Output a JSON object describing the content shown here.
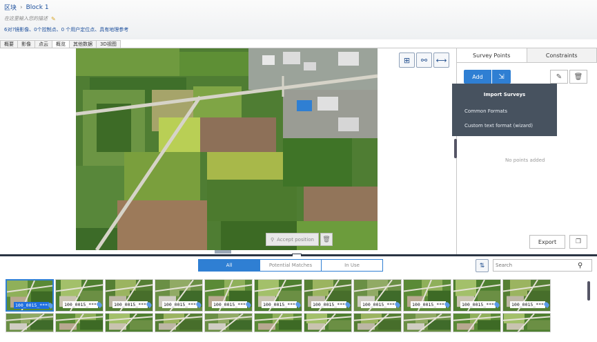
{
  "header": {
    "breadcrumb": [
      "区块",
      "Block 1"
    ],
    "breadcrumb_sep": "›",
    "description_placeholder": "在这里输入您的描述",
    "stats": "6对?镜影像、0个控制点、0 个用户定位点、具有地理参考"
  },
  "tabs": [
    "概要",
    "影像",
    "点云",
    "概览",
    "其他数据",
    "3D视图"
  ],
  "active_tab": 3,
  "viewport": {
    "accept_label": "Accept position",
    "view_buttons": [
      "grid-view-icon",
      "pan-zoom-icon",
      "measure-icon"
    ]
  },
  "right_panel": {
    "tabs": [
      "Survey Points",
      "Constraints"
    ],
    "active_tab": 0,
    "add_label": "Add",
    "import_menu": {
      "title": "Import Surveys",
      "items": [
        "Common Formats",
        "Custom text format (wizard)"
      ]
    },
    "empty_text": "No points added",
    "export_label": "Export"
  },
  "bottom": {
    "filters": [
      "All",
      "Potential Matches",
      "In Use"
    ],
    "active_filter": 0,
    "search_placeholder": "Search",
    "thumb_label": "100_0015_***"
  },
  "colors": {
    "accent": "#2f7fd3",
    "splitter": "#2a3443",
    "menu_bg": "#47525f"
  }
}
